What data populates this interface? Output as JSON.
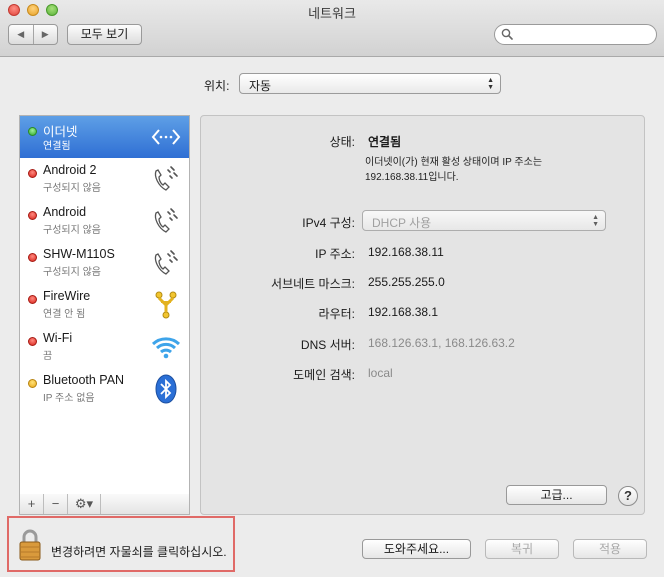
{
  "window": {
    "title": "네트워크"
  },
  "toolbar": {
    "back": "◀",
    "forward": "▶",
    "show_all": "모두 보기",
    "search_placeholder": ""
  },
  "location": {
    "label": "위치:",
    "value": "자동"
  },
  "services": [
    {
      "name": "이더넷",
      "status": "연결됨",
      "dot": "green",
      "icon": "ethernet-icon",
      "selected": true
    },
    {
      "name": "Android 2",
      "status": "구성되지 않음",
      "dot": "red",
      "icon": "phone-icon"
    },
    {
      "name": "Android",
      "status": "구성되지 않음",
      "dot": "red",
      "icon": "phone-icon"
    },
    {
      "name": "SHW-M110S",
      "status": "구성되지 않음",
      "dot": "red",
      "icon": "phone-icon"
    },
    {
      "name": "FireWire",
      "status": "연결 안 됨",
      "dot": "red",
      "icon": "firewire-icon"
    },
    {
      "name": "Wi-Fi",
      "status": "끔",
      "dot": "red",
      "icon": "wifi-icon"
    },
    {
      "name": "Bluetooth PAN",
      "status": "IP 주소 없음",
      "dot": "yellow",
      "icon": "bluetooth-icon"
    }
  ],
  "sidebar_footer": {
    "add": "+",
    "remove": "−",
    "action": "⚙▾"
  },
  "detail": {
    "status_label": "상태:",
    "status_value": "연결됨",
    "status_desc_1": "이더넷이(가) 현재 활성 상태이며 IP 주소는",
    "status_desc_2": "192.168.38.11입니다.",
    "ipv4_label": "IPv4 구성:",
    "ipv4_value": "DHCP 사용",
    "ip_label": "IP 주소:",
    "ip_value": "192.168.38.11",
    "subnet_label": "서브네트 마스크:",
    "subnet_value": "255.255.255.0",
    "router_label": "라우터:",
    "router_value": "192.168.38.1",
    "dns_label": "DNS 서버:",
    "dns_value": "168.126.63.1, 168.126.63.2",
    "domain_label": "도메인 검색:",
    "domain_value": "local",
    "advanced_button": "고급...",
    "help_button": "?"
  },
  "footer": {
    "lock_text": "변경하려면 자물쇠를 클릭하십시오.",
    "assist_button": "도와주세요...",
    "revert_button": "복귀",
    "apply_button": "적용"
  },
  "colors": {
    "selection": "#3d7fdb",
    "highlight_frame": "#e06a67"
  }
}
